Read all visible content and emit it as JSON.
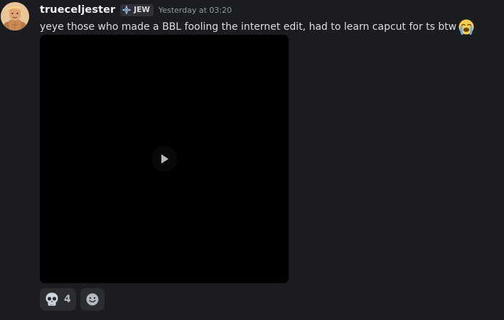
{
  "message": {
    "username": "trueceljester",
    "role_tag": "JEW",
    "timestamp": "Yesterday at 03:20",
    "text": "yeye those who made a BBL fooling the internet edit, had to learn capcut for ts btw",
    "text_emoji": "loudly-crying-face-icon"
  },
  "attachment": {
    "type": "video",
    "play_icon": "play-icon"
  },
  "reactions": [
    {
      "emoji": "skull-icon",
      "count": "4"
    }
  ],
  "add_reaction_icon": "smiley-icon",
  "colors": {
    "background": "#1b1c20",
    "username": "#f2f3f5",
    "timestamp": "#949ba4",
    "reaction_bg": "#2b2d31"
  }
}
